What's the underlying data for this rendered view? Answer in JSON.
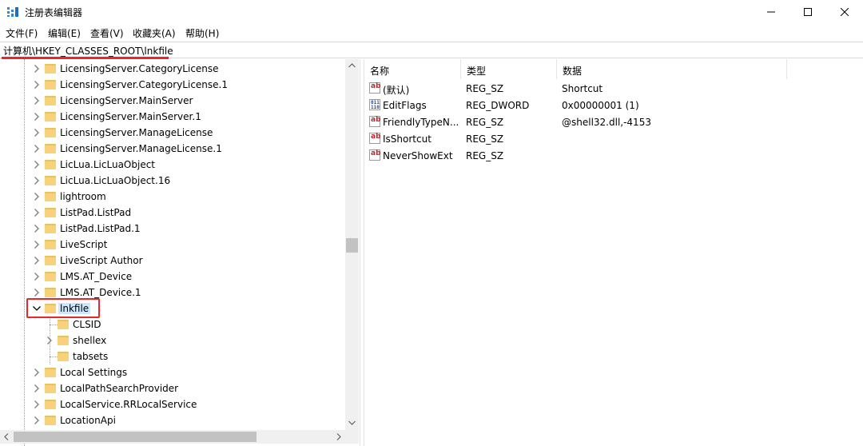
{
  "window": {
    "title": "注册表编辑器"
  },
  "menu": [
    "文件(F)",
    "编辑(E)",
    "查看(V)",
    "收藏夹(A)",
    "帮助(H)"
  ],
  "address": {
    "path": "计算机\\HKEY_CLASSES_ROOT\\lnkfile"
  },
  "tree": [
    {
      "label": "LicensingServer.CategoryLicense",
      "level": 1,
      "expander": "right",
      "selected": false
    },
    {
      "label": "LicensingServer.CategoryLicense.1",
      "level": 1,
      "expander": "right",
      "selected": false
    },
    {
      "label": "LicensingServer.MainServer",
      "level": 1,
      "expander": "right",
      "selected": false
    },
    {
      "label": "LicensingServer.MainServer.1",
      "level": 1,
      "expander": "right",
      "selected": false
    },
    {
      "label": "LicensingServer.ManageLicense",
      "level": 1,
      "expander": "right",
      "selected": false
    },
    {
      "label": "LicensingServer.ManageLicense.1",
      "level": 1,
      "expander": "right",
      "selected": false
    },
    {
      "label": "LicLua.LicLuaObject",
      "level": 1,
      "expander": "right",
      "selected": false
    },
    {
      "label": "LicLua.LicLuaObject.16",
      "level": 1,
      "expander": "right",
      "selected": false
    },
    {
      "label": "lightroom",
      "level": 1,
      "expander": "right",
      "selected": false
    },
    {
      "label": "ListPad.ListPad",
      "level": 1,
      "expander": "right",
      "selected": false
    },
    {
      "label": "ListPad.ListPad.1",
      "level": 1,
      "expander": "right",
      "selected": false
    },
    {
      "label": "LiveScript",
      "level": 1,
      "expander": "right",
      "selected": false
    },
    {
      "label": "LiveScript Author",
      "level": 1,
      "expander": "right",
      "selected": false
    },
    {
      "label": "LMS.AT_Device",
      "level": 1,
      "expander": "right",
      "selected": false
    },
    {
      "label": "LMS.AT_Device.1",
      "level": 1,
      "expander": "right",
      "selected": false
    },
    {
      "label": "lnkfile",
      "level": 1,
      "expander": "down",
      "selected": true
    },
    {
      "label": "CLSID",
      "level": 2,
      "expander": "none",
      "selected": false
    },
    {
      "label": "shellex",
      "level": 2,
      "expander": "right",
      "selected": false
    },
    {
      "label": "tabsets",
      "level": 2,
      "expander": "none",
      "selected": false
    },
    {
      "label": "Local Settings",
      "level": 1,
      "expander": "right",
      "selected": false
    },
    {
      "label": "LocalPathSearchProvider",
      "level": 1,
      "expander": "right",
      "selected": false
    },
    {
      "label": "LocalService.RRLocalService",
      "level": 1,
      "expander": "right",
      "selected": false
    },
    {
      "label": "LocationApi",
      "level": 1,
      "expander": "right",
      "selected": false
    }
  ],
  "columns": {
    "name": "名称",
    "type": "类型",
    "data": "数据"
  },
  "values": [
    {
      "name": "(默认)",
      "type": "REG_SZ",
      "data": "Shortcut",
      "icon": "string-value-icon"
    },
    {
      "name": "EditFlags",
      "type": "REG_DWORD",
      "data": "0x00000001 (1)",
      "icon": "binary-value-icon"
    },
    {
      "name": "FriendlyTypeN...",
      "type": "REG_SZ",
      "data": "@shell32.dll,-4153",
      "icon": "string-value-icon"
    },
    {
      "name": "IsShortcut",
      "type": "REG_SZ",
      "data": "",
      "icon": "string-value-icon"
    },
    {
      "name": "NeverShowExt",
      "type": "REG_SZ",
      "data": "",
      "icon": "string-value-icon"
    }
  ],
  "colors": {
    "selection": "#cce8ff",
    "highlight_red": "#e8262b",
    "folder": "#f7d27a"
  }
}
